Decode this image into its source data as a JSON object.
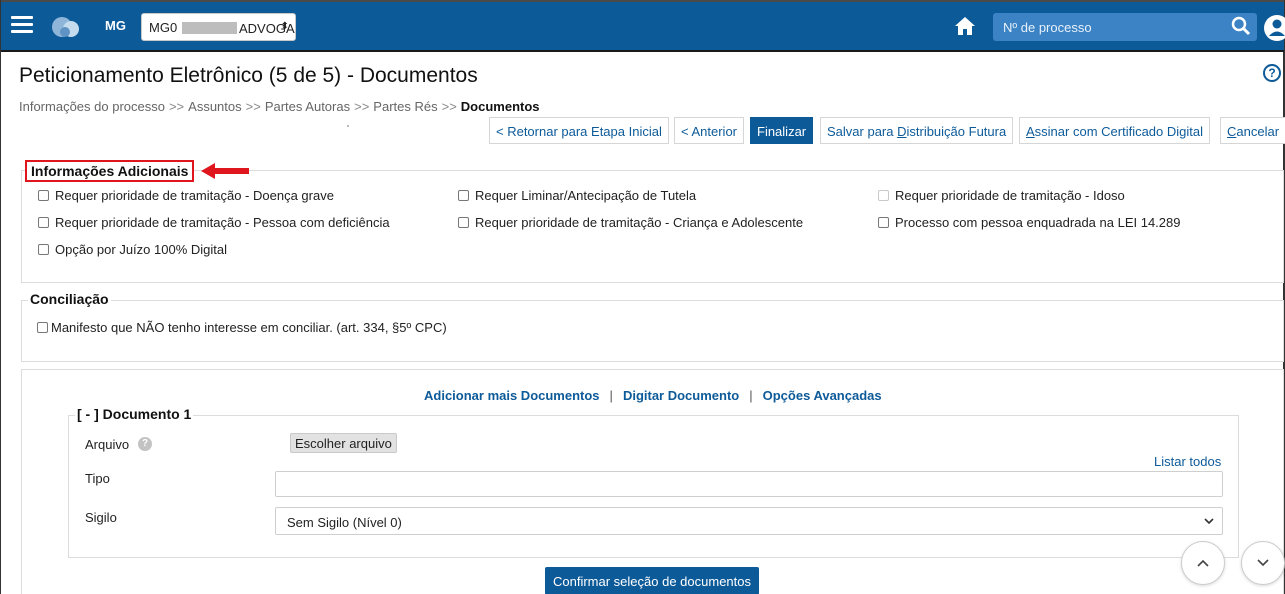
{
  "header": {
    "org": "MG",
    "select_prefix": "MG0",
    "select_suffix": "ADVOGA",
    "search_placeholder": "Nº de processo"
  },
  "page": {
    "title": "Peticionamento Eletrônico (5 de 5) - Documentos",
    "help": "?"
  },
  "breadcrumb": {
    "items": [
      "Informações do processo",
      "Assuntos",
      "Partes Autoras",
      "Partes Rés"
    ],
    "separator": ">>",
    "current": "Documentos"
  },
  "actions": {
    "return": "< Retornar para Etapa Inicial",
    "previous": "< Anterior",
    "finish": "Finalizar",
    "save_pre": "Salvar para ",
    "save_u": "D",
    "save_post": "istribuição Futura",
    "sign_u": "A",
    "sign_post": "ssinar com Certificado Digital",
    "cancel_u": "C",
    "cancel_post": "ancelar"
  },
  "info_adicionais": {
    "title": "Informações Adicionais",
    "options": [
      "Requer prioridade de tramitação - Doença grave",
      "Requer Liminar/Antecipação de Tutela",
      "Requer prioridade de tramitação - Idoso",
      "Requer prioridade de tramitação - Pessoa com deficiência",
      "Requer prioridade de tramitação - Criança e Adolescente",
      "Processo com pessoa enquadrada na LEI 14.289",
      "Opção por Juízo 100% Digital"
    ]
  },
  "conciliacao": {
    "title": "Conciliação",
    "option": "Manifesto que NÃO tenho interesse em conciliar. (art. 334, §5º CPC)"
  },
  "documents": {
    "links": [
      "Adicionar mais Documentos",
      "Digitar Documento",
      "Opções Avançadas"
    ],
    "link_separator": "|",
    "doc_title": "[ - ] Documento 1",
    "arquivo_label": "Arquivo",
    "file_button": "Escolher arquivo",
    "listar_todos": "Listar todos",
    "tipo_label": "Tipo",
    "sigilo_label": "Sigilo",
    "sigilo_value": "Sem Sigilo (Nível 0)",
    "confirm": "Confirmar seleção de documentos"
  },
  "colors": {
    "primary": "#0d5a99",
    "highlight": "#e0161e",
    "search_bg": "#3b83c4"
  }
}
